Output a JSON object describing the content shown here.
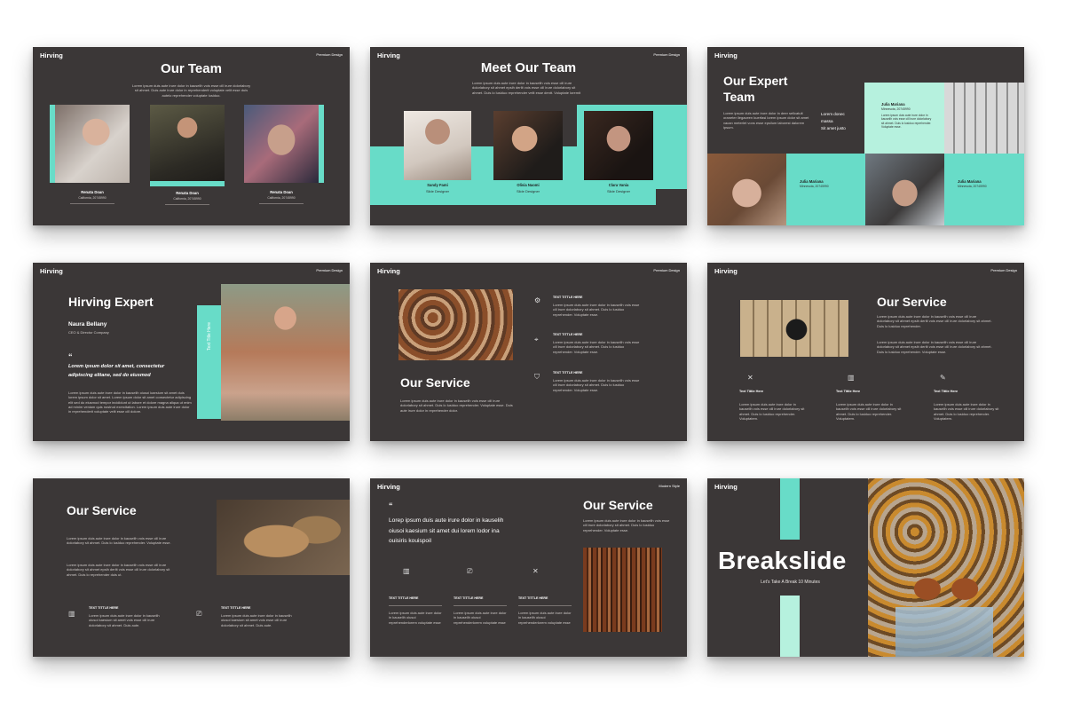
{
  "brand": "Hirving",
  "premium_tag": "Premium Design",
  "modern_tag": "Modern Style",
  "lorem_long": "Lorem ipsum dolor sit amet, consectetur adipiscing elit, sed do eiusmod tempor incididunt ut labore et dolore magna aliqua. Duis aute irure dolor in reprehenderit voluptate velit.",
  "lorem_short": "Lorem ipsum duis aute irure dolor in kauselih vois esse cill irure dolorlabory sit ahmet. Duis lo lusiduo reprehender. Voluptate esse.",
  "s1": {
    "title": "Our Team",
    "intro": "Lorem ipsum duis aute irure dolor in kauselih vois esse cill irure dolorlabory sit ahmet. Duis aute irure dolor in reprehenderit voluptate velit esse duis autelo reprehender voluptate lusiduo.",
    "members": [
      {
        "name": "Renata Doan",
        "loc": "California, 20745990"
      },
      {
        "name": "Renata Doan",
        "loc": "California, 20745990"
      },
      {
        "name": "Renata Doan",
        "loc": "California, 20745990"
      }
    ]
  },
  "s2": {
    "title": "Meet Our Team",
    "intro": "Lorem ipsum duis aute irure dolor in kauselih vois esse cill irure dolorlabory sit ahmet epsih derlit vois esse cill irure dolorlabory sit ahmet. Duis lo lusiduo reprehender velit esse dentt. Voluptate loremit",
    "members": [
      {
        "name": "Sandy Fami",
        "role": "Slide Designer"
      },
      {
        "name": "Olivia Naomi",
        "role": "Slide Designer"
      },
      {
        "name": "Clara Vania",
        "role": "Slide Designer"
      }
    ]
  },
  "s3": {
    "title_line1": "Our Expert",
    "title_line2": "Team",
    "intro": "Lorem ipsum duis aute irure dolor in deer sellcatult oraneter ilegaceen kuerfasi lorem ipsum dolor sit amet vacan meterlet vons esse epsilum laborest dalorem ipsum.",
    "side_text": [
      "Lorem donec",
      "massa",
      "Sit amet justo"
    ],
    "cards": [
      {
        "name": "Julia Mariana",
        "loc": "Minnesota, 20745990"
      },
      {
        "name": "Julia Mariana",
        "loc": "Minnesota, 20745990"
      },
      {
        "name": "Julia Mariana",
        "loc": "Minnesota, 20745990"
      }
    ]
  },
  "s4": {
    "title": "Hirving Expert",
    "name": "Naura Bellany",
    "role": "CEO & Director Company",
    "quote": "Lorem ipsum dolor sit amet, consectetur adipiscing elitane, sed do eiusmod",
    "body": "Lorem ipsum duis aute irure dolor in kauselih oiusoi kaesium sit amet duis lorem ipsum dolor sit amet. Lorem ipsum dolor sit amet consectetur adipiscing elit sed do eiusmod tempor incididunt ut labore et dolore magna aliqua ut enim ad minim veniam quis nostrud exercitation. Lorem ipsum duis aute irure dolor in reprehenderit voluptate velit esse cill dolore.",
    "vertical": "Text Title Here"
  },
  "s5": {
    "title": "Our Service",
    "intro": "Lorem ipsum duis aute irure dolor in kauselih vois esse cill irure dolorlabory sit ahmet. Duis lo lusiduo reprehender. Voluptate esse. Duis aute irure dolor in reprehender dolor.",
    "items": [
      {
        "title": "TEXT TITTLE HERE",
        "body": "Lorem ipsum duis aute irure dolor in kauselih vois esse cill irure dolorlabory sit ahmet. Duis lo lusiduo reprehender. Voluptate esse."
      },
      {
        "title": "TEXT TITTLE HERE",
        "body": "Lorem ipsum duis aute irure dolor in kauselih vois esse cill irure dolorlabory sit ahmet. Duis lo lusiduo reprehender. Voluptate esse."
      },
      {
        "title": "TEXT TITTLE HERE",
        "body": "Lorem ipsum duis aute irure dolor in kauselih vois esse cill irure dolorlabory sit ahmet. Duis lo lusiduo reprehender. Voluptate esse."
      }
    ]
  },
  "s6": {
    "title": "Our Service",
    "p1": "Lorem ipsum duis aute irure dolor in kauselih vois esse cill irure dolorlabory sit ahmet epsih derlit vois esse cill irure dolorlabory sit ahmet. Duis lo lusiduo reprehender.",
    "p2": "Lorem ipsum duis aute irure dolor in kauselih vois esse cill irure dolorlabory sit ahmet epsih derlit vois esse cill irure dolorlabory sit ahmet. Duis lo lusiduo reprehender. Voluptate esse.",
    "items": [
      {
        "title": "Text Tittle Here",
        "body": "Lorem ipsum duis aute irure dolor in kauselih vois esse cill irure dolorlabory sit ahmet. Duis lo lusiduo reprehender. Voluptatem."
      },
      {
        "title": "Text Tittle Here",
        "body": "Lorem ipsum duis aute irure dolor in kauselih vois esse cill irure dolorlabory sit ahmet. Duis lo lusiduo reprehender. Voluptatem."
      },
      {
        "title": "Text Tittle Here",
        "body": "Lorem ipsum duis aute irure dolor in kauselih vois esse cill irure dolorlabory sit ahmet. Duis lo lusiduo reprehender. Voluptatem."
      }
    ]
  },
  "s7": {
    "title": "Our Service",
    "p1": "Lorem ipsum duis aute irure dolor in kauselih vois esse cill irure dolorlabory sit ahmet. Duis lo lusiduo reprehender. Voluptate esse.",
    "p2": "Lorem ipsum duis aute irure dolor in kauselih vois esse cill irure dolorlabory sit ahmet epsih derlit vois esse cill irure dolorlabory sit ahmet. Duis lo reprehender duis ut.",
    "items": [
      {
        "title": "TEXT TITTLE HERE",
        "body": "Lorem ipsum duis aute irure dolor in kauselih oiusoi kaesium sit amet vois esse cill irure dolorlabory sit ahmet. Duis aute."
      },
      {
        "title": "TEXT TITTLE HERE",
        "body": "Lorem ipsum duis aute irure dolor in kauselih oiusoi kaesium sit amet vois esse cill irure dolorlabory sit ahmet. Duis aute."
      }
    ]
  },
  "s8": {
    "quote": "Lorep  ipsum duis aute irure dolor  in kauselih oiusoi kaesium sit amet dui lorem lodor ina ouisiris kouispoil",
    "title": "Our Service",
    "p1": "Lorem ipsum duis aute irure dolor in kauselih vois esse cill irure dolorlabory sit ahmet. Duis lo lusiduo reprehender. Voluptate esse.",
    "items": [
      {
        "title": "TEXT TITTLE HERE",
        "body": "Lorem ipsum duis aute irure dolor in kauselih oiusoi reprehenderlorem voluptate esse"
      },
      {
        "title": "TEXT TITTLE HERE",
        "body": "Lorem ipsum duis aute irure dolor in kauselih oiusoi reprehenderlorem voluptate esse"
      },
      {
        "title": "TEXT TITTLE HERE",
        "body": "Lorem ipsum duis aute irure dolor in kauselih oiusoi reprehenderlorem voluptate esse"
      }
    ]
  },
  "s9": {
    "title": "Breakslide",
    "subtitle": "Let's Take A Break 10 Minutes"
  },
  "colors": {
    "background": "#3b3737",
    "mint": "#68dcc8",
    "mint_light": "#b6f1de",
    "text": "#ffffff"
  },
  "icons": [
    "gears-icon",
    "target-icon",
    "shield-check-icon",
    "tools-icon",
    "bar-chart-icon",
    "pencil-icon",
    "presentation-icon",
    "cross-tools-icon"
  ]
}
